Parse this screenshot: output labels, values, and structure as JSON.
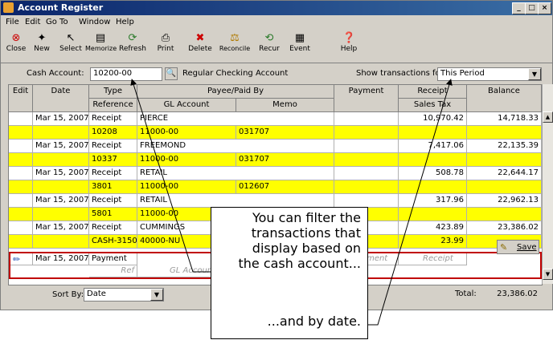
{
  "window": {
    "title": "Account Register",
    "controls": [
      "_",
      "□",
      "×"
    ]
  },
  "menu": [
    "File",
    "Edit",
    "Go To",
    "Window",
    "Help"
  ],
  "toolbar": [
    {
      "label": "Close",
      "icon": "close-icon"
    },
    {
      "label": "New",
      "icon": "new-icon"
    },
    {
      "label": "Select",
      "icon": "select-icon"
    },
    {
      "label": "Memorize",
      "icon": "memorize-icon"
    },
    {
      "label": "Refresh",
      "icon": "refresh-icon"
    },
    {
      "label": "Print",
      "icon": "print-icon"
    },
    {
      "label": "Delete",
      "icon": "delete-icon"
    },
    {
      "label": "Reconcile",
      "icon": "reconcile-icon"
    },
    {
      "label": "Recur",
      "icon": "recur-icon"
    },
    {
      "label": "Event",
      "icon": "event-icon"
    },
    {
      "label": "Help",
      "icon": "help-icon"
    }
  ],
  "filter": {
    "cash_account_label": "Cash Account:",
    "cash_account_value": "10200-00",
    "account_name": "Regular Checking Account",
    "show_label": "Show transactions for:",
    "show_value": "This Period"
  },
  "columns": {
    "edit": "Edit",
    "date": "Date",
    "type": "Type",
    "payee": "Payee/Paid By",
    "payment": "Payment",
    "receipt": "Receipt",
    "balance": "Balance",
    "reference": "Reference",
    "gl_account": "GL Account",
    "memo": "Memo",
    "sales_tax": "Sales Tax"
  },
  "rows": [
    {
      "date": "Mar 15, 2007",
      "type": "Receipt",
      "payee": "PIERCE",
      "receipt": "10,970.42",
      "balance": "14,718.33",
      "ref": "10208",
      "gl": "11000-00",
      "memo": "031707",
      "tax": ""
    },
    {
      "date": "Mar 15, 2007",
      "type": "Receipt",
      "payee": "FREEMOND",
      "receipt": "7,417.06",
      "balance": "22,135.39",
      "ref": "10337",
      "gl": "11000-00",
      "memo": "031707",
      "tax": ""
    },
    {
      "date": "Mar 15, 2007",
      "type": "Receipt",
      "payee": "RETAIL",
      "receipt": "508.78",
      "balance": "22,644.17",
      "ref": "3801",
      "gl": "11000-00",
      "memo": "012607",
      "tax": ""
    },
    {
      "date": "Mar 15, 2007",
      "type": "Receipt",
      "payee": "RETAIL",
      "receipt": "317.96",
      "balance": "22,962.13",
      "ref": "5801",
      "gl": "11000-00",
      "memo": "",
      "tax": ""
    },
    {
      "date": "Mar 15, 2007",
      "type": "Receipt",
      "payee": "CUMMINGS",
      "receipt": "423.89",
      "balance": "23,386.02",
      "ref": "CASH-31503",
      "gl": "40000-NU",
      "memo": "",
      "tax": "23.99"
    }
  ],
  "new_row": {
    "date": "Mar 15, 2007",
    "type": "Payment",
    "ref_placeholder": "Ref",
    "gl_placeholder": "GL Account",
    "payment_placeholder": "Payment",
    "receipt_placeholder": "Receipt"
  },
  "save_label": "Save",
  "bottom": {
    "sort_label": "Sort By:",
    "sort_value": "Date",
    "total_label": "Total:",
    "total_value": "23,386.02"
  },
  "callout": {
    "text1": "You can filter the",
    "text2": "transactions that",
    "text3": "display based on",
    "text4": "the cash account...",
    "text5": "...and by date."
  },
  "colors": {
    "title_bar": "#0a246a",
    "row_highlight": "#ffff00",
    "active_row_border": "#c00000"
  }
}
